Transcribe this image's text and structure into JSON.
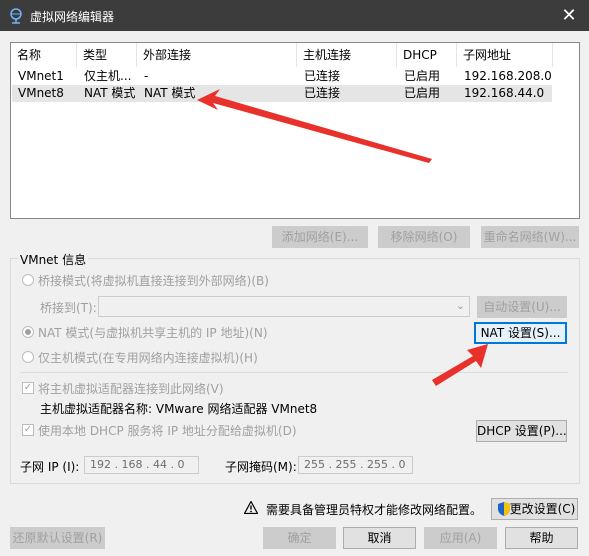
{
  "window": {
    "title": "虚拟网络编辑器",
    "close": "✕"
  },
  "list": {
    "columns": [
      "名称",
      "类型",
      "外部连接",
      "主机连接",
      "DHCP",
      "子网地址"
    ],
    "rows": [
      {
        "name": "VMnet1",
        "type": "仅主机...",
        "external": "-",
        "host": "已连接",
        "dhcp": "已启用",
        "subnet": "192.168.208.0"
      },
      {
        "name": "VMnet8",
        "type": "NAT 模式",
        "external": "NAT 模式",
        "host": "已连接",
        "dhcp": "已启用",
        "subnet": "192.168.44.0"
      }
    ]
  },
  "list_buttons": {
    "add": "添加网络(E)...",
    "remove": "移除网络(O)",
    "rename": "重命名网络(W)..."
  },
  "vmnet": {
    "group_label": "VMnet 信息",
    "bridged_label": "桥接模式(将虚拟机直接连接到外部网络)(B)",
    "bridge_to_label": "桥接到(T):",
    "auto_settings": "自动设置(U)...",
    "nat_label": "NAT 模式(与虚拟机共享主机的 IP 地址)(N)",
    "nat_settings": "NAT 设置(S)...",
    "hostonly_label": "仅主机模式(在专用网络内连接虚拟机)(H)",
    "connect_adapter_label": "将主机虚拟适配器连接到此网络(V)",
    "adapter_name_label": "主机虚拟适配器名称: VMware 网络适配器 VMnet8",
    "dhcp_label": "使用本地 DHCP 服务将 IP 地址分配给虚拟机(D)",
    "dhcp_settings": "DHCP 设置(P)...",
    "subnet_ip_label": "子网 IP (I):",
    "subnet_ip_value": "192 . 168 . 44 . 0",
    "subnet_mask_label": "子网掩码(M):",
    "subnet_mask_value": "255 . 255 . 255 . 0"
  },
  "footer": {
    "admin_notice": "需要具备管理员特权才能修改网络配置。",
    "change_settings": "更改设置(C)",
    "restore_defaults": "还原默认设置(R)",
    "ok": "确定",
    "cancel": "取消",
    "apply": "应用(A)",
    "help": "帮助"
  },
  "colors": {
    "titlebar": "#3c3c3c",
    "annotation_arrow": "#e8312a",
    "focus_border": "#0078d7"
  }
}
